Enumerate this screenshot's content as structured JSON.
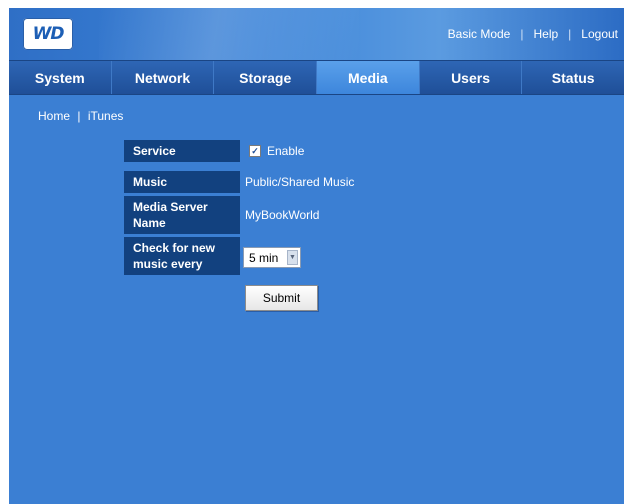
{
  "brand": {
    "logo_text": "WD"
  },
  "header": {
    "links": [
      "Basic Mode",
      "Help",
      "Logout"
    ],
    "separator": "|"
  },
  "nav": {
    "tabs": [
      "System",
      "Network",
      "Storage",
      "Media",
      "Users",
      "Status"
    ],
    "active": "Media"
  },
  "breadcrumb": {
    "home": "Home",
    "separator": "|",
    "current": "iTunes"
  },
  "form": {
    "service": {
      "label": "Service",
      "checkbox_checked": true,
      "checkbox_label": "Enable"
    },
    "music": {
      "label": "Music",
      "value": "Public/Shared Music"
    },
    "media_server_name": {
      "label_line1": "Media Server",
      "label_line2": "Name",
      "value": "MyBookWorld"
    },
    "check_interval": {
      "label_line1": "Check for new",
      "label_line2": "music every",
      "selected": "5 min"
    },
    "submit_label": "Submit"
  },
  "colors": {
    "background": "#3b7fd3",
    "label_bg": "#12417f",
    "nav_bg": "#1f4f98",
    "active_tab": "#4d95e4"
  }
}
